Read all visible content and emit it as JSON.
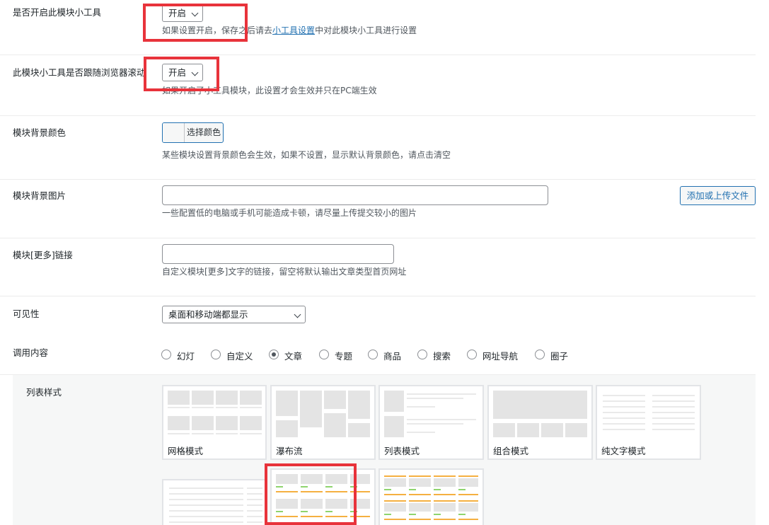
{
  "rows": {
    "widget_enable": {
      "label": "是否开启此模块小工具",
      "select_value": "开启",
      "desc_before": "如果设置开启，保存",
      "desc_hidden": "之",
      "desc_mid": "后请去",
      "desc_link": "小工具设置",
      "desc_after": "中对此模块小工具进行设置"
    },
    "follow_scroll": {
      "label": "此模块小工具是否跟随浏览器滚动",
      "select_value": "开启",
      "desc": "如果开启了小工具模块，此设置才会生效并只在PC端生效"
    },
    "bg_color": {
      "label": "模块背景颜色",
      "button_label": "选择颜色",
      "desc": "某些模块设置背景颜色会生效，如果不设置，显示默认背景颜色，请点击清空"
    },
    "bg_image": {
      "label": "模块背景图片",
      "input_value": "",
      "button_label": "添加或上传文件",
      "desc": "一些配置低的电脑或手机可能造成卡顿，请尽量上传提交较小的图片"
    },
    "more_link": {
      "label": "模块[更多]链接",
      "input_value": "",
      "desc": "自定义模块[更多]文字的链接，留空将默认输出文章类型首页网址"
    },
    "visibility": {
      "label": "可见性",
      "select_value": "桌面和移动端都显示"
    },
    "content": {
      "label": "调用内容",
      "options": [
        "幻灯",
        "自定义",
        "文章",
        "专题",
        "商品",
        "搜索",
        "网址导航",
        "圈子"
      ],
      "selected": "文章"
    },
    "list_style": {
      "label": "列表样式",
      "styles": [
        "网格模式",
        "瀑布流",
        "列表模式",
        "组合模式",
        "纯文字模式",
        "",
        "",
        ""
      ]
    }
  },
  "colors": {
    "highlight": "#e8333b",
    "link": "#2271b1",
    "accent_orange": "#f5b041",
    "accent_green": "#8fd46e"
  }
}
